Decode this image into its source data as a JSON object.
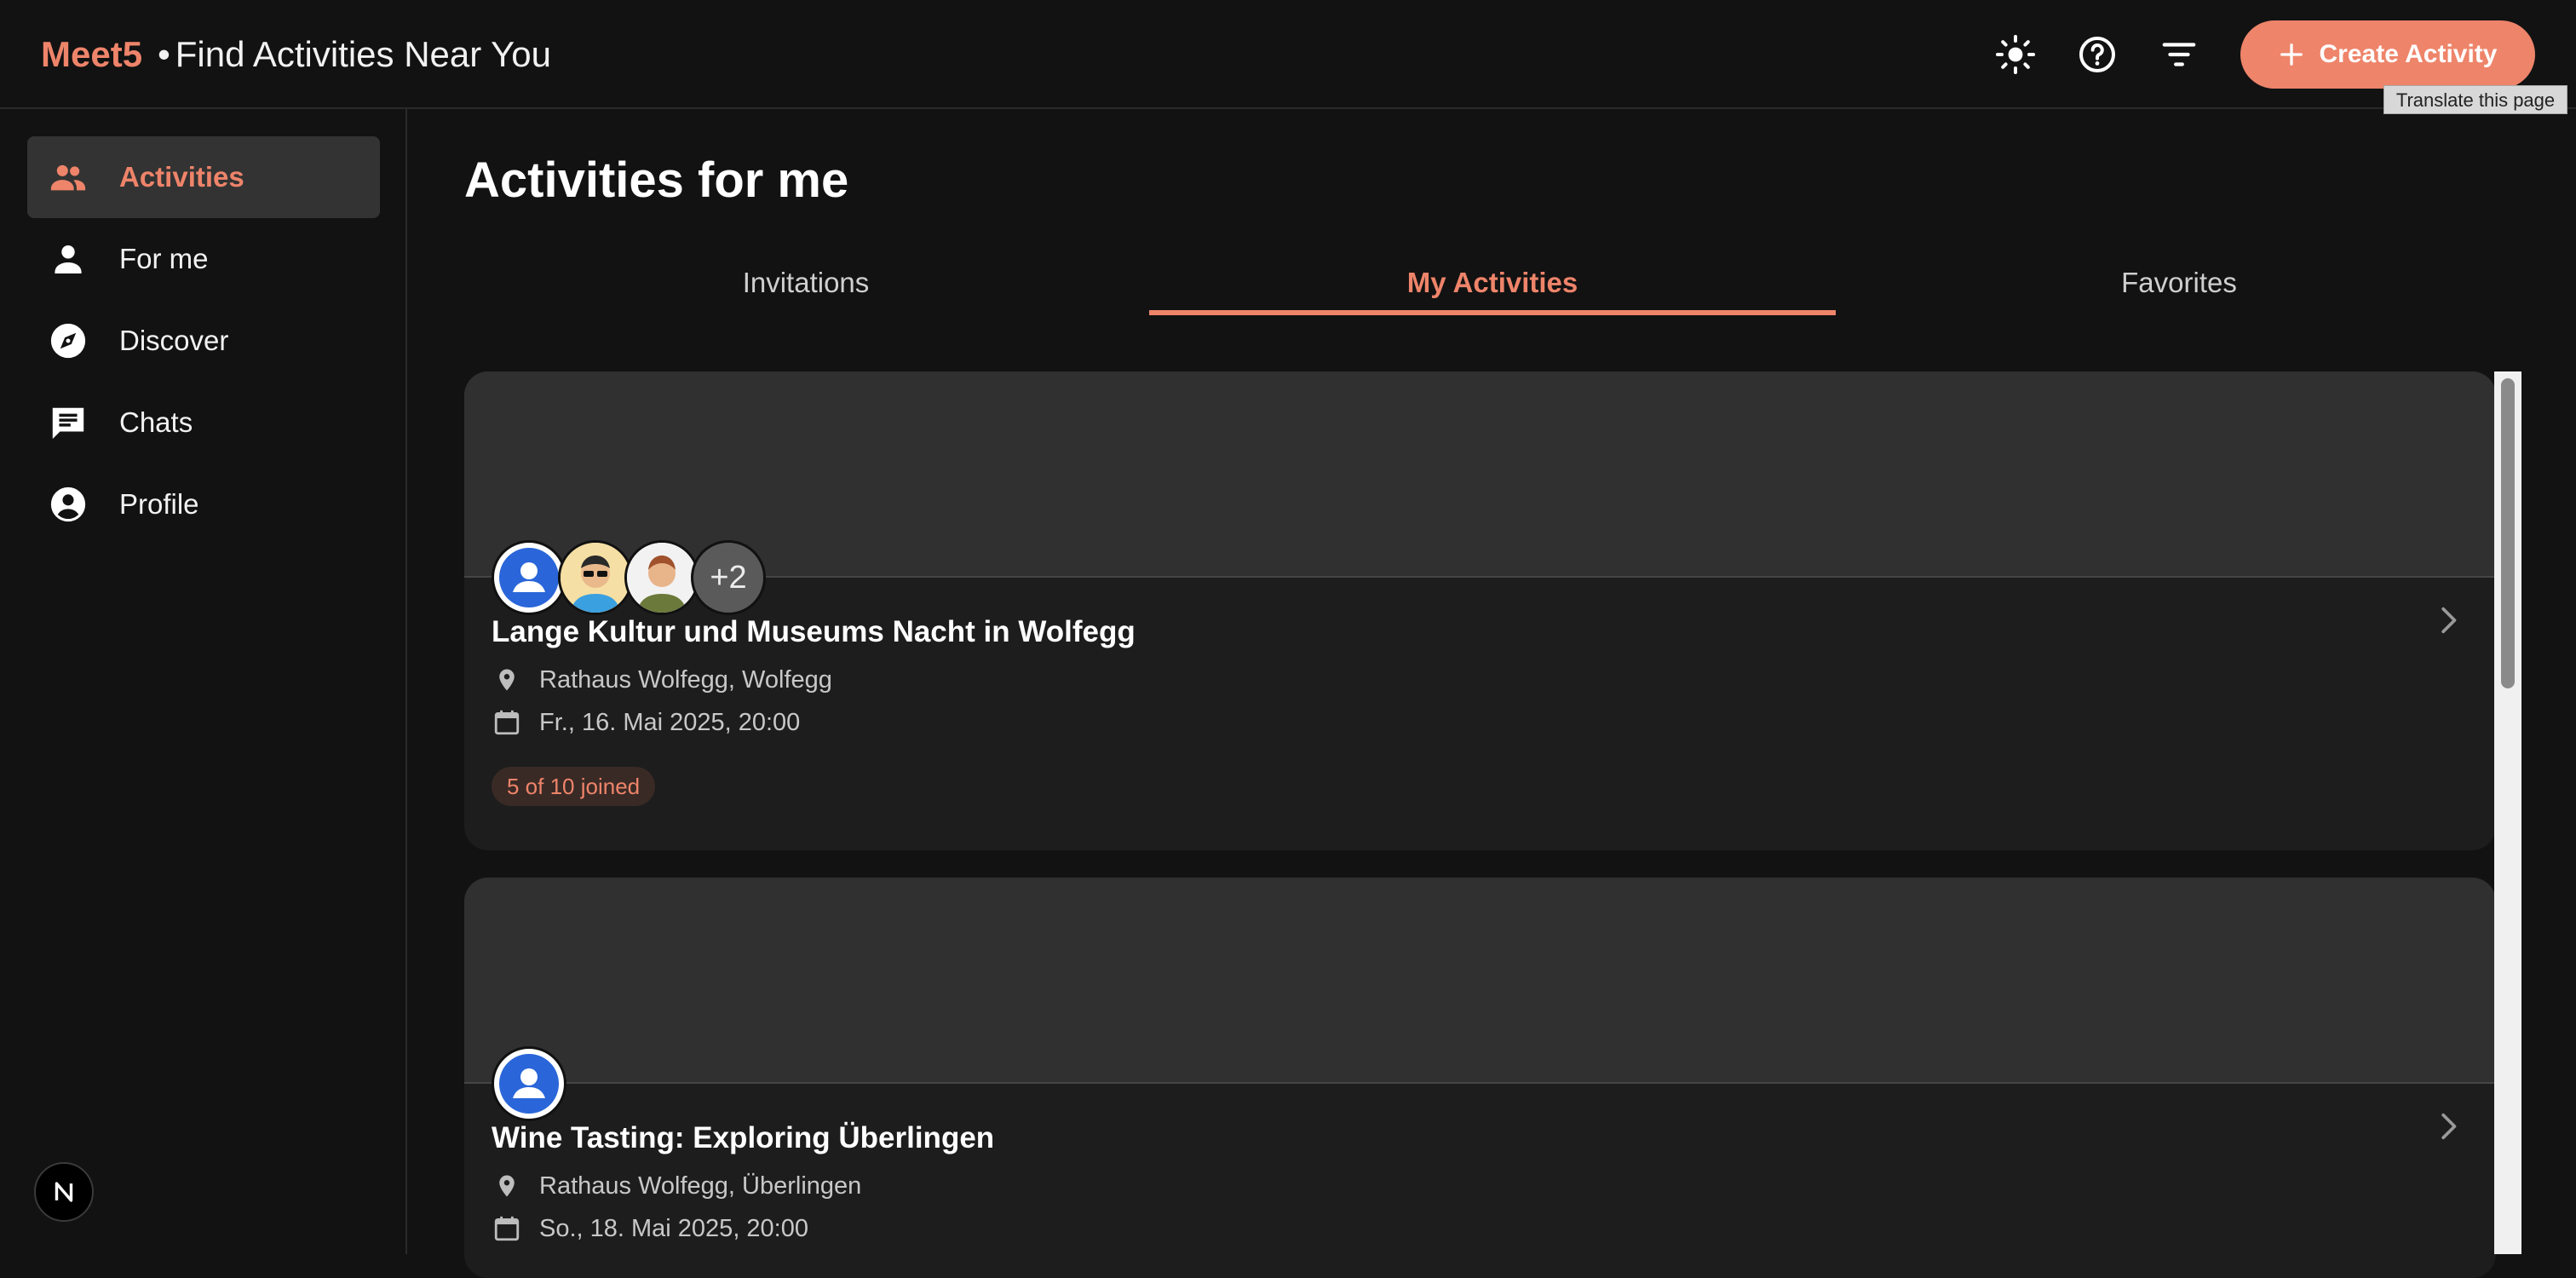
{
  "header": {
    "brand": "Meet5",
    "separator": "•",
    "title": "Find Activities Near You",
    "create_label": "Create Activity",
    "tooltip": "Translate this page"
  },
  "sidebar": {
    "items": [
      {
        "label": "Activities",
        "icon": "people-icon",
        "active": true
      },
      {
        "label": "For me",
        "icon": "person-icon"
      },
      {
        "label": "Discover",
        "icon": "compass-icon"
      },
      {
        "label": "Chats",
        "icon": "chat-icon"
      },
      {
        "label": "Profile",
        "icon": "account-circle-icon"
      }
    ],
    "badge": "N"
  },
  "main": {
    "title": "Activities for me",
    "tabs": [
      {
        "label": "Invitations"
      },
      {
        "label": "My Activities",
        "active": true
      },
      {
        "label": "Favorites"
      }
    ]
  },
  "activities": [
    {
      "title": "Lange Kultur und Museums Nacht in Wolfegg",
      "location": "Rathaus Wolfegg, Wolfegg",
      "date": "Fr., 16. Mai 2025, 20:00",
      "joined": "5 of 10 joined",
      "more_participants": "+2"
    },
    {
      "title": "Wine Tasting: Exploring Überlingen",
      "location": "Rathaus Wolfegg, Überlingen",
      "date": "So., 18. Mai 2025, 20:00"
    }
  ],
  "colors": {
    "accent": "#ee846a",
    "background": "#121212",
    "card": "#1d1d1d"
  }
}
